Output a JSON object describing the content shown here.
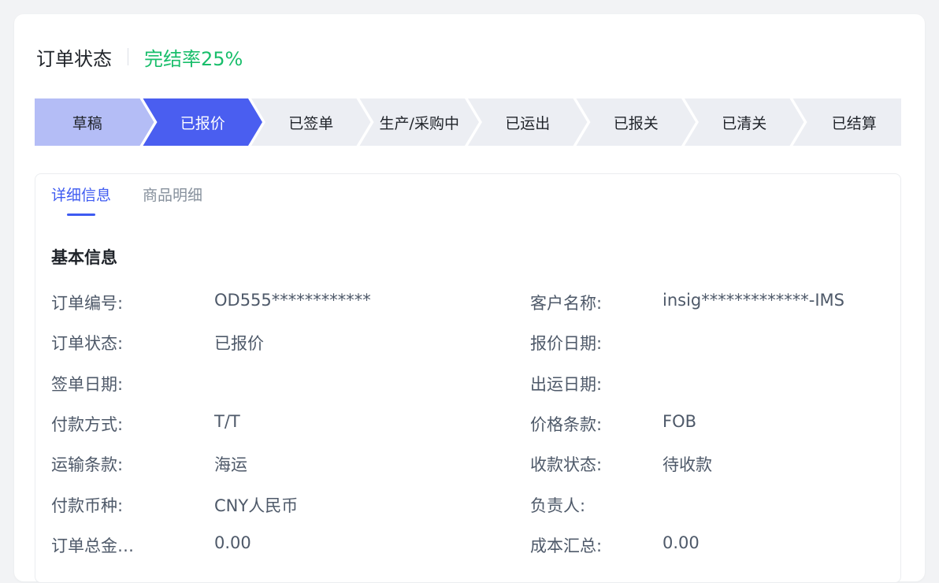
{
  "header": {
    "title": "订单状态",
    "completion": "完结率25%"
  },
  "colors": {
    "accent": "#4a5ef0",
    "done_step": "#b4bdf6",
    "pending_step": "#eceef3",
    "success": "#19be6b"
  },
  "steps": [
    {
      "label": "草稿",
      "state": "done"
    },
    {
      "label": "已报价",
      "state": "active"
    },
    {
      "label": "已签单",
      "state": "pending"
    },
    {
      "label": "生产/采购中",
      "state": "pending"
    },
    {
      "label": "已运出",
      "state": "pending"
    },
    {
      "label": "已报关",
      "state": "pending"
    },
    {
      "label": "已清关",
      "state": "pending"
    },
    {
      "label": "已结算",
      "state": "pending"
    }
  ],
  "tabs": [
    {
      "label": "详细信息",
      "active": true
    },
    {
      "label": "商品明细",
      "active": false
    }
  ],
  "section": {
    "title": "基本信息"
  },
  "fields": [
    {
      "left_label": "订单编号:",
      "left_value": "OD555************",
      "right_label": "客户名称:",
      "right_value": "insig*************-IMS"
    },
    {
      "left_label": "订单状态:",
      "left_value": "已报价",
      "right_label": "报价日期:",
      "right_value": ""
    },
    {
      "left_label": "签单日期:",
      "left_value": "",
      "right_label": "出运日期:",
      "right_value": ""
    },
    {
      "left_label": "付款方式:",
      "left_value": "T/T",
      "right_label": "价格条款:",
      "right_value": "FOB"
    },
    {
      "left_label": "运输条款:",
      "left_value": "海运",
      "right_label": "收款状态:",
      "right_value": "待收款"
    },
    {
      "left_label": "付款币种:",
      "left_value": "CNY人民币",
      "right_label": "负责人:",
      "right_value": ""
    },
    {
      "left_label": "订单总金…",
      "left_value": "0.00",
      "right_label": "成本汇总:",
      "right_value": "0.00"
    }
  ]
}
